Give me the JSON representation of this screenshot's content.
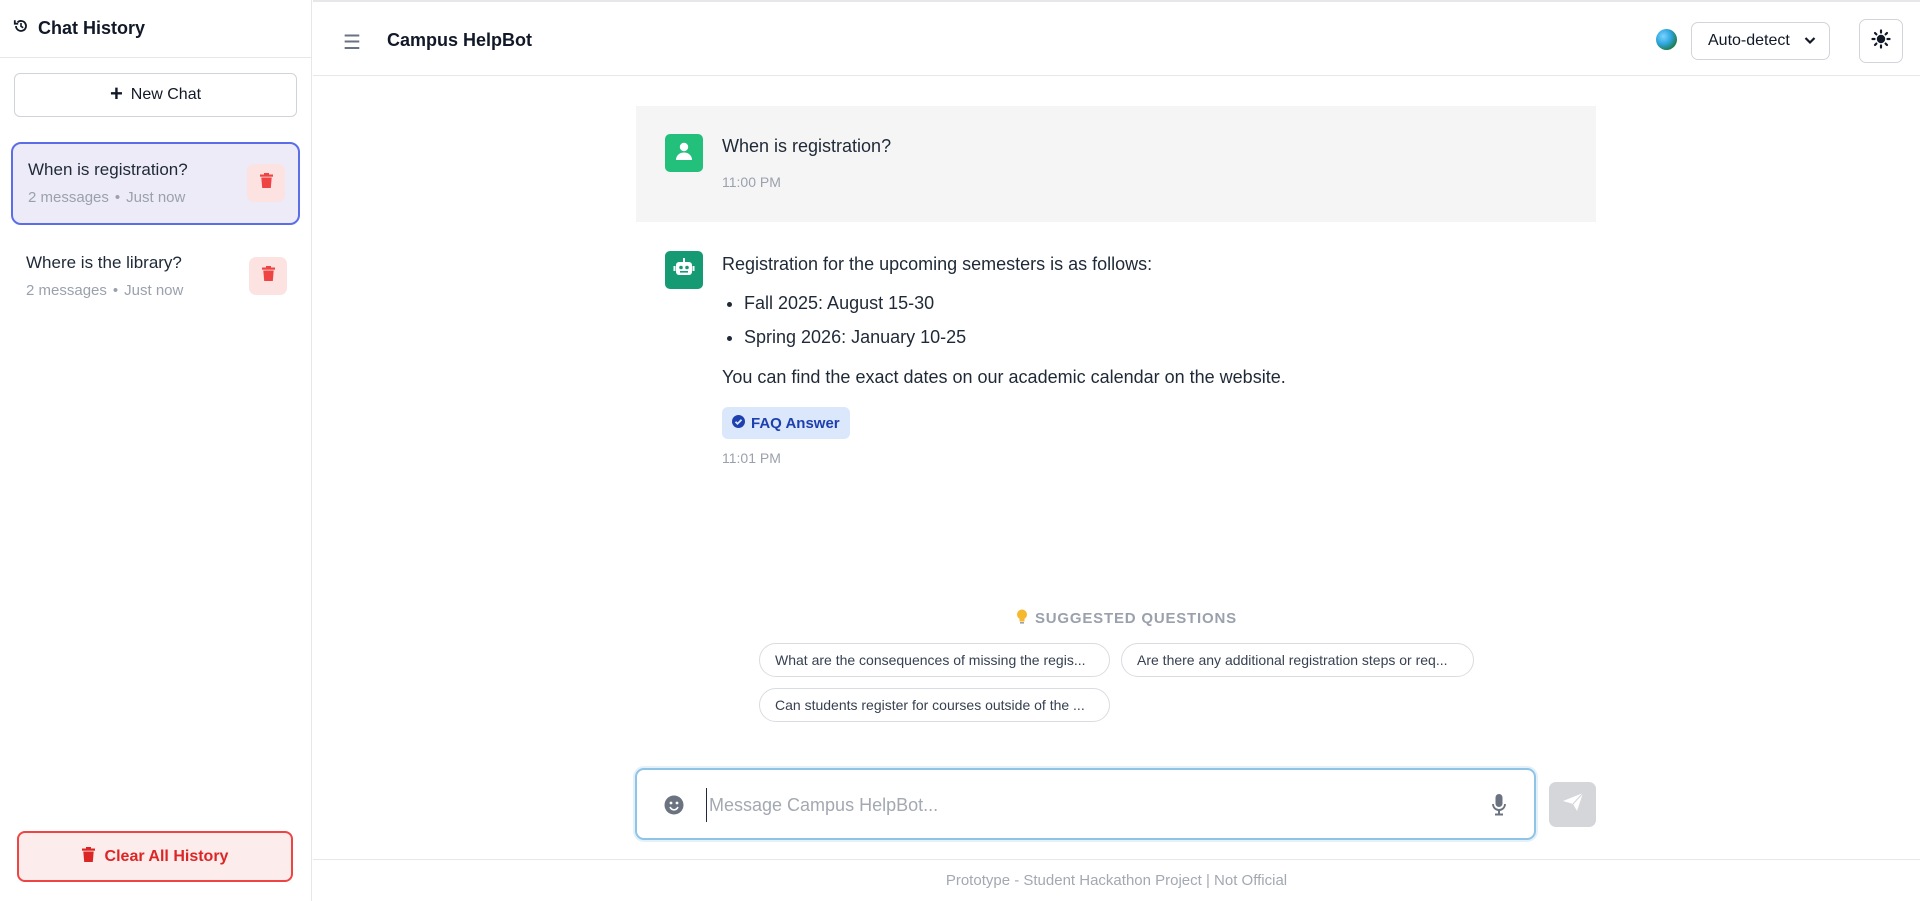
{
  "sidebar": {
    "title": "Chat History",
    "new_chat_label": "New Chat",
    "chats": [
      {
        "title": "When is registration?",
        "count": "2 messages",
        "time": "Just now",
        "active": true
      },
      {
        "title": "Where is the library?",
        "count": "2 messages",
        "time": "Just now",
        "active": false
      }
    ],
    "clear_all_label": "Clear All History"
  },
  "header": {
    "title": "Campus HelpBot",
    "language": "Auto-detect"
  },
  "conversation": {
    "user_message": {
      "text": "When is registration?",
      "time": "11:00 PM"
    },
    "bot_message": {
      "intro": "Registration for the upcoming semesters is as follows:",
      "bullets": [
        "Fall 2025: August 15-30",
        "Spring 2026: January 10-25"
      ],
      "outro": "You can find the exact dates on our academic calendar on the website.",
      "badge": "FAQ Answer",
      "time": "11:01 PM"
    }
  },
  "suggestions": {
    "heading": "SUGGESTED QUESTIONS",
    "items": [
      "What are the consequences of missing the regis...",
      "Are there any additional registration steps or req...",
      "Can students register for courses outside of the ..."
    ]
  },
  "composer": {
    "placeholder": "Message Campus HelpBot...",
    "value": ""
  },
  "footer": {
    "text": "Prototype - Student Hackathon Project | Not Official"
  },
  "colors": {
    "accent": "#5b6ee8",
    "danger": "#ef4444",
    "user_avatar": "#22c07a",
    "bot_avatar": "#169a73",
    "badge_bg": "#dbe7fb"
  }
}
